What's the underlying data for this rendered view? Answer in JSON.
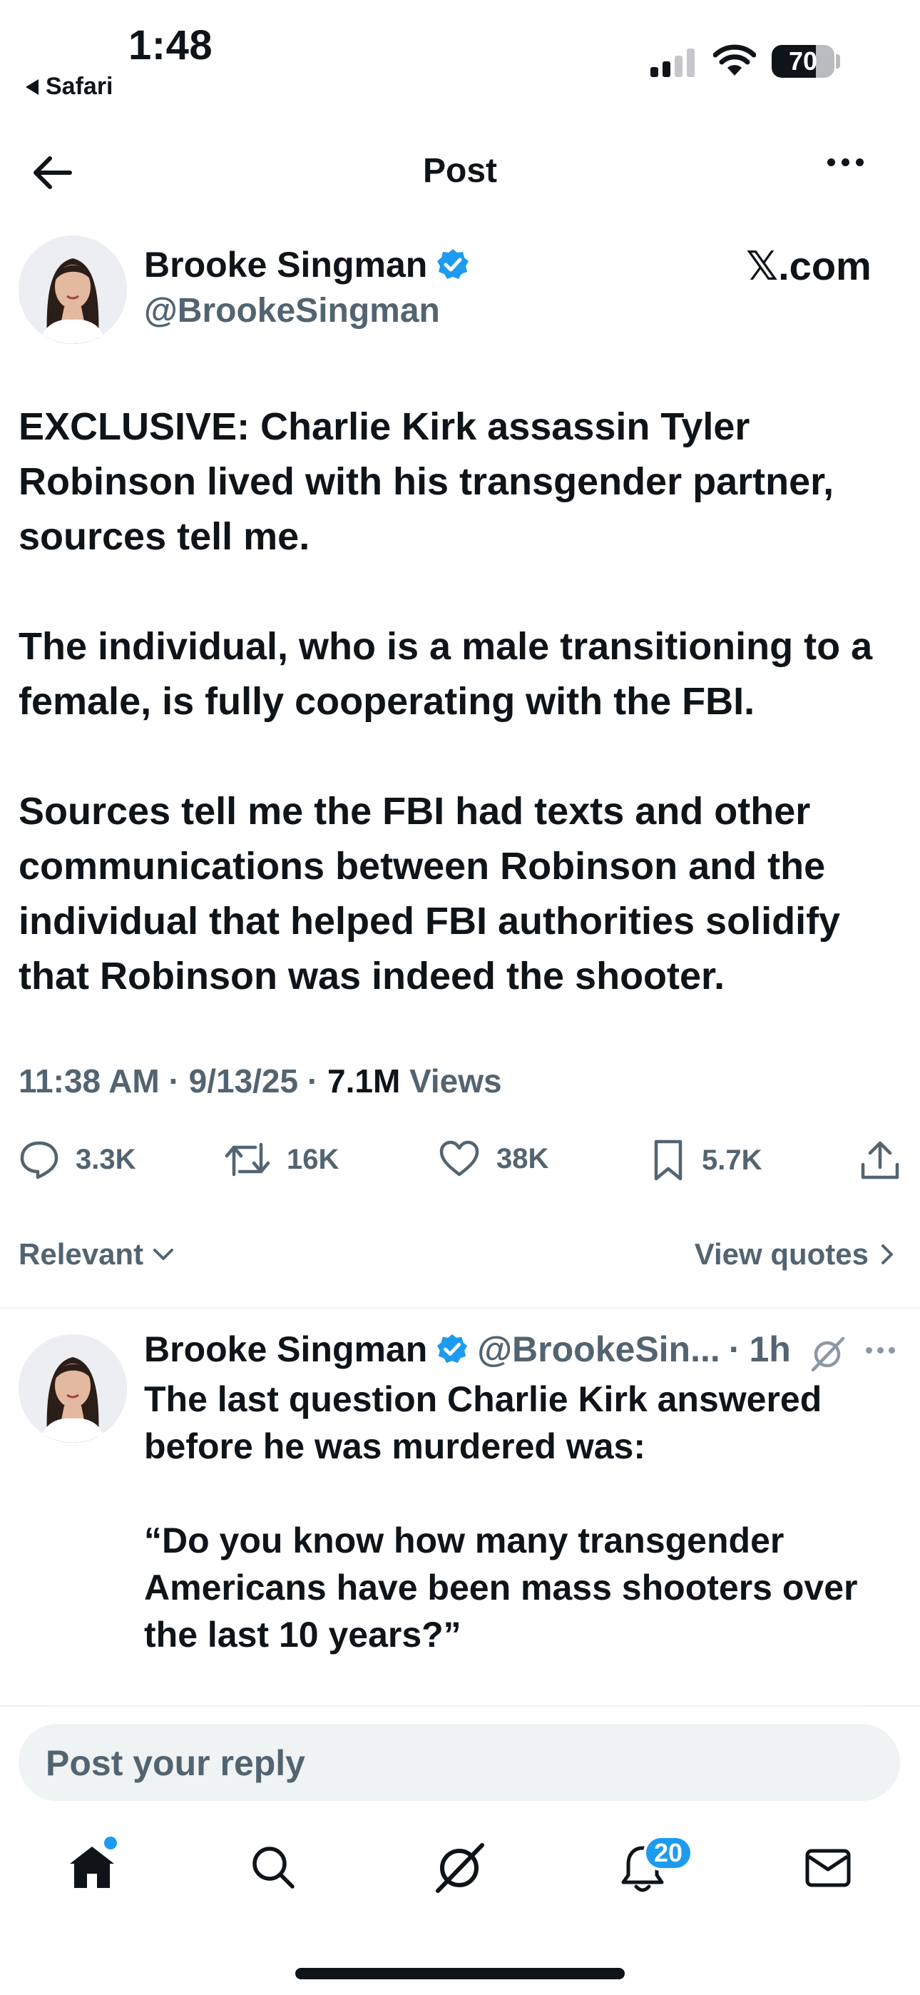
{
  "status_bar": {
    "time": "1:48",
    "back_app": "Safari",
    "battery": "70",
    "battery_level": 0.7,
    "signal_bars": 2
  },
  "header": {
    "title": "Post"
  },
  "post": {
    "author": {
      "name": "Brooke Singman",
      "handle": "@BrookeSingman",
      "verified": true
    },
    "source_label": "X.com",
    "paragraphs": [
      "EXCLUSIVE: Charlie Kirk assassin Tyler Robinson lived with his transgender partner, sources tell me.",
      "The individual, who is a male transitioning to a female, is fully cooperating with the FBI.",
      "Sources tell me the FBI had texts and other communications between Robinson and the individual that helped FBI authorities solidify that Robinson was indeed the shooter."
    ],
    "meta": {
      "time": "11:38 AM",
      "date": "9/13/25",
      "views_count": "7.1M",
      "views_label": "Views",
      "sep": "·"
    },
    "actions": {
      "replies": "3.3K",
      "reposts": "16K",
      "likes": "38K",
      "bookmarks": "5.7K"
    }
  },
  "sort": {
    "label": "Relevant",
    "quotes": "View quotes"
  },
  "reply": {
    "name": "Brooke Singman",
    "handle": "@BrookeSin...",
    "sep": "·",
    "age": "1h",
    "paragraphs": [
      "The last question Charlie Kirk answered before he was murdered was:",
      "“Do you know how many transgender Americans have been mass shooters over the last 10 years?”"
    ]
  },
  "composer": {
    "placeholder": "Post your reply"
  },
  "tabbar": {
    "notifications_badge": "20"
  },
  "colors": {
    "accent": "#1d9bf0",
    "text": "#0f1419",
    "secondary": "#536471",
    "divider": "#eff3f4"
  }
}
